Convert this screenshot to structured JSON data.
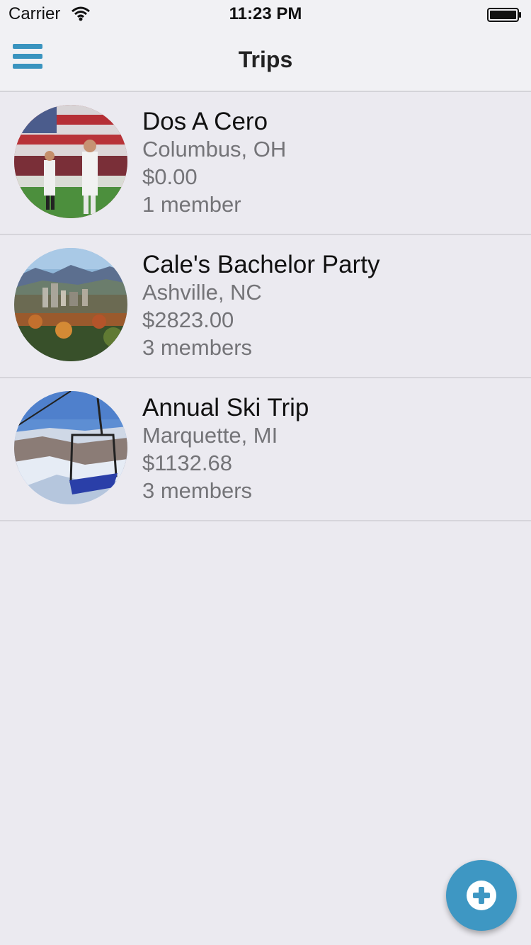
{
  "status_bar": {
    "carrier": "Carrier",
    "time": "11:23 PM"
  },
  "nav": {
    "title": "Trips",
    "menu_icon": "hamburger-menu-icon"
  },
  "trips": [
    {
      "name": "Dos A Cero",
      "location": "Columbus, OH",
      "amount": "$0.00",
      "members": "1 member",
      "thumb": "soccer-stadium-photo"
    },
    {
      "name": "Cale's Bachelor Party",
      "location": "Ashville, NC",
      "amount": "$2823.00",
      "members": "3 members",
      "thumb": "city-mountains-photo"
    },
    {
      "name": "Annual Ski Trip",
      "location": "Marquette, MI",
      "amount": "$1132.68",
      "members": "3 members",
      "thumb": "ski-lift-photo"
    }
  ],
  "fab": {
    "icon": "add-circle-icon"
  },
  "colors": {
    "accent": "#3e97c3",
    "background": "#ebeaf0",
    "bar": "#f1f1f4",
    "secondary_text": "#747478"
  }
}
